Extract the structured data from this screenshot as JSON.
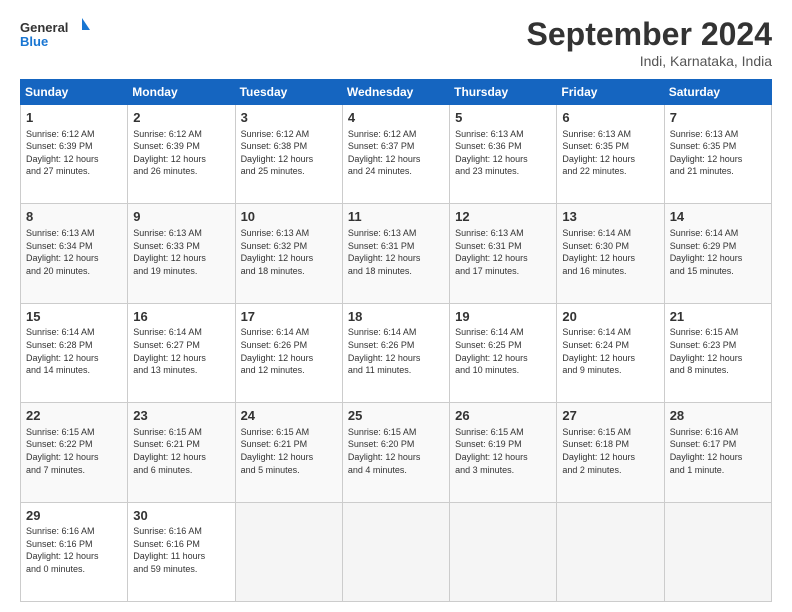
{
  "logo": {
    "line1": "General",
    "line2": "Blue"
  },
  "title": "September 2024",
  "subtitle": "Indi, Karnataka, India",
  "days": [
    "Sunday",
    "Monday",
    "Tuesday",
    "Wednesday",
    "Thursday",
    "Friday",
    "Saturday"
  ],
  "weeks": [
    [
      {
        "day": "1",
        "info": "Sunrise: 6:12 AM\nSunset: 6:39 PM\nDaylight: 12 hours\nand 27 minutes."
      },
      {
        "day": "2",
        "info": "Sunrise: 6:12 AM\nSunset: 6:39 PM\nDaylight: 12 hours\nand 26 minutes."
      },
      {
        "day": "3",
        "info": "Sunrise: 6:12 AM\nSunset: 6:38 PM\nDaylight: 12 hours\nand 25 minutes."
      },
      {
        "day": "4",
        "info": "Sunrise: 6:12 AM\nSunset: 6:37 PM\nDaylight: 12 hours\nand 24 minutes."
      },
      {
        "day": "5",
        "info": "Sunrise: 6:13 AM\nSunset: 6:36 PM\nDaylight: 12 hours\nand 23 minutes."
      },
      {
        "day": "6",
        "info": "Sunrise: 6:13 AM\nSunset: 6:35 PM\nDaylight: 12 hours\nand 22 minutes."
      },
      {
        "day": "7",
        "info": "Sunrise: 6:13 AM\nSunset: 6:35 PM\nDaylight: 12 hours\nand 21 minutes."
      }
    ],
    [
      {
        "day": "8",
        "info": "Sunrise: 6:13 AM\nSunset: 6:34 PM\nDaylight: 12 hours\nand 20 minutes."
      },
      {
        "day": "9",
        "info": "Sunrise: 6:13 AM\nSunset: 6:33 PM\nDaylight: 12 hours\nand 19 minutes."
      },
      {
        "day": "10",
        "info": "Sunrise: 6:13 AM\nSunset: 6:32 PM\nDaylight: 12 hours\nand 18 minutes."
      },
      {
        "day": "11",
        "info": "Sunrise: 6:13 AM\nSunset: 6:31 PM\nDaylight: 12 hours\nand 18 minutes."
      },
      {
        "day": "12",
        "info": "Sunrise: 6:13 AM\nSunset: 6:31 PM\nDaylight: 12 hours\nand 17 minutes."
      },
      {
        "day": "13",
        "info": "Sunrise: 6:14 AM\nSunset: 6:30 PM\nDaylight: 12 hours\nand 16 minutes."
      },
      {
        "day": "14",
        "info": "Sunrise: 6:14 AM\nSunset: 6:29 PM\nDaylight: 12 hours\nand 15 minutes."
      }
    ],
    [
      {
        "day": "15",
        "info": "Sunrise: 6:14 AM\nSunset: 6:28 PM\nDaylight: 12 hours\nand 14 minutes."
      },
      {
        "day": "16",
        "info": "Sunrise: 6:14 AM\nSunset: 6:27 PM\nDaylight: 12 hours\nand 13 minutes."
      },
      {
        "day": "17",
        "info": "Sunrise: 6:14 AM\nSunset: 6:26 PM\nDaylight: 12 hours\nand 12 minutes."
      },
      {
        "day": "18",
        "info": "Sunrise: 6:14 AM\nSunset: 6:26 PM\nDaylight: 12 hours\nand 11 minutes."
      },
      {
        "day": "19",
        "info": "Sunrise: 6:14 AM\nSunset: 6:25 PM\nDaylight: 12 hours\nand 10 minutes."
      },
      {
        "day": "20",
        "info": "Sunrise: 6:14 AM\nSunset: 6:24 PM\nDaylight: 12 hours\nand 9 minutes."
      },
      {
        "day": "21",
        "info": "Sunrise: 6:15 AM\nSunset: 6:23 PM\nDaylight: 12 hours\nand 8 minutes."
      }
    ],
    [
      {
        "day": "22",
        "info": "Sunrise: 6:15 AM\nSunset: 6:22 PM\nDaylight: 12 hours\nand 7 minutes."
      },
      {
        "day": "23",
        "info": "Sunrise: 6:15 AM\nSunset: 6:21 PM\nDaylight: 12 hours\nand 6 minutes."
      },
      {
        "day": "24",
        "info": "Sunrise: 6:15 AM\nSunset: 6:21 PM\nDaylight: 12 hours\nand 5 minutes."
      },
      {
        "day": "25",
        "info": "Sunrise: 6:15 AM\nSunset: 6:20 PM\nDaylight: 12 hours\nand 4 minutes."
      },
      {
        "day": "26",
        "info": "Sunrise: 6:15 AM\nSunset: 6:19 PM\nDaylight: 12 hours\nand 3 minutes."
      },
      {
        "day": "27",
        "info": "Sunrise: 6:15 AM\nSunset: 6:18 PM\nDaylight: 12 hours\nand 2 minutes."
      },
      {
        "day": "28",
        "info": "Sunrise: 6:16 AM\nSunset: 6:17 PM\nDaylight: 12 hours\nand 1 minute."
      }
    ],
    [
      {
        "day": "29",
        "info": "Sunrise: 6:16 AM\nSunset: 6:16 PM\nDaylight: 12 hours\nand 0 minutes."
      },
      {
        "day": "30",
        "info": "Sunrise: 6:16 AM\nSunset: 6:16 PM\nDaylight: 11 hours\nand 59 minutes."
      },
      {
        "day": "",
        "info": ""
      },
      {
        "day": "",
        "info": ""
      },
      {
        "day": "",
        "info": ""
      },
      {
        "day": "",
        "info": ""
      },
      {
        "day": "",
        "info": ""
      }
    ]
  ]
}
